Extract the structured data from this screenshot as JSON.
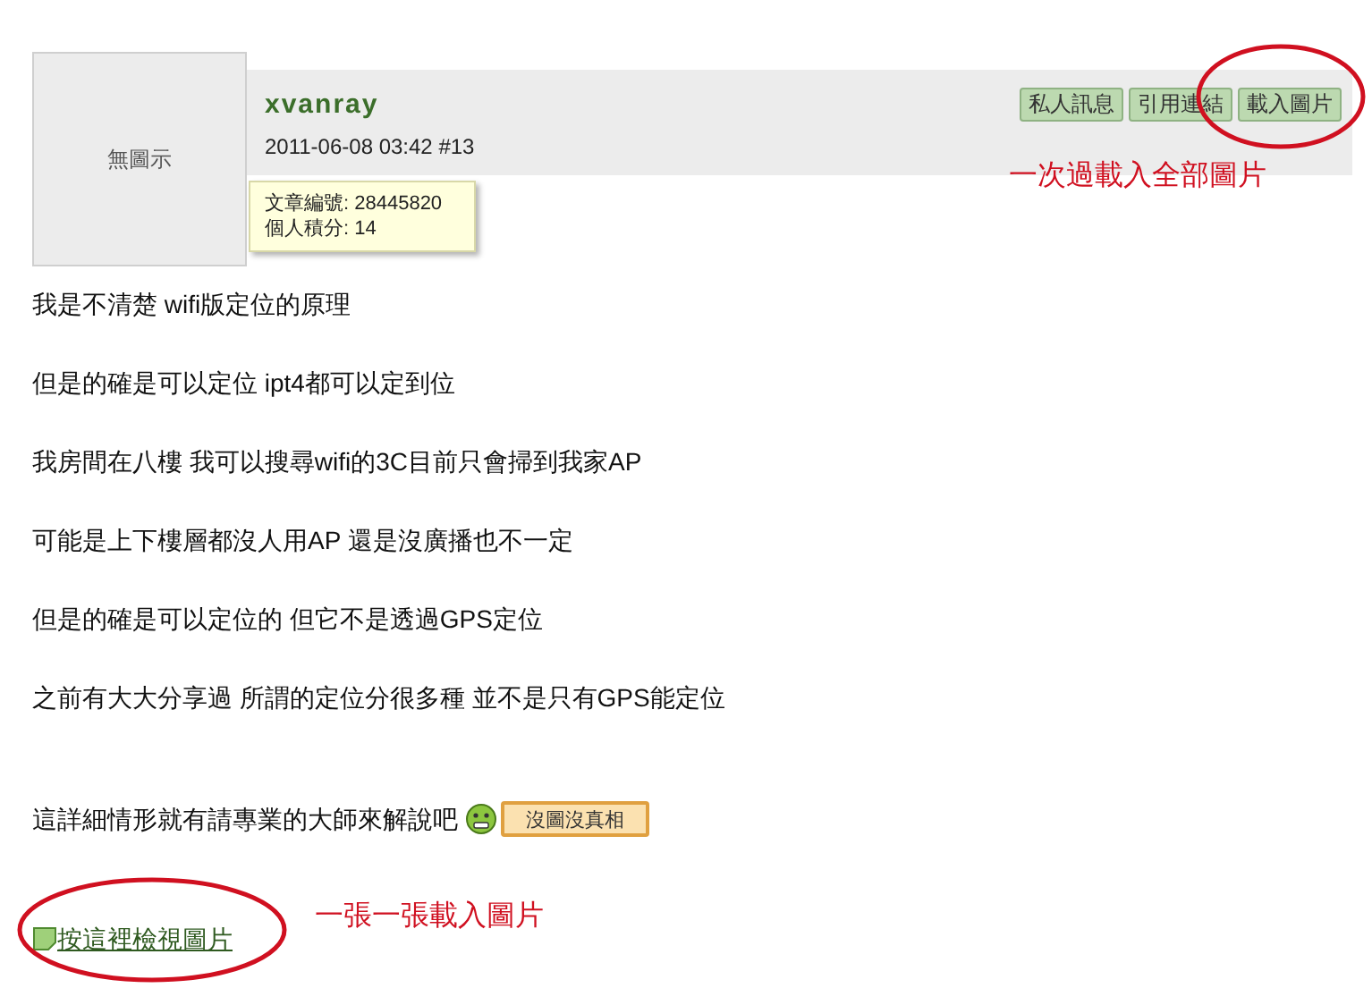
{
  "post": {
    "avatar_text": "無圖示",
    "username": "xvanray",
    "meta": "2011-06-08 03:42 #13",
    "buttons": [
      "私人訊息",
      "引用連結",
      "載入圖片"
    ],
    "tooltip": [
      "文章編號: 28445820",
      "個人積分: 14"
    ],
    "paragraphs": [
      "我是不清楚 wifi版定位的原理",
      "但是的確是可以定位 ipt4都可以定到位",
      "我房間在八樓 我可以搜尋wifi的3C目前只會掃到我家AP",
      "可能是上下樓層都沒人用AP 還是沒廣播也不一定",
      "但是的確是可以定位的 但它不是透過GPS定位",
      "之前有大大分享過 所謂的定位分很多種 並不是只有GPS能定位"
    ],
    "closing": "這詳細情形就有請專業的大師來解說吧",
    "sticker": "沒圖沒真相",
    "image_link": "按這裡檢視圖片"
  },
  "annotations": [
    {
      "text": "一次過載入全部圖片"
    },
    {
      "text": "一張一張載入圖片"
    }
  ]
}
